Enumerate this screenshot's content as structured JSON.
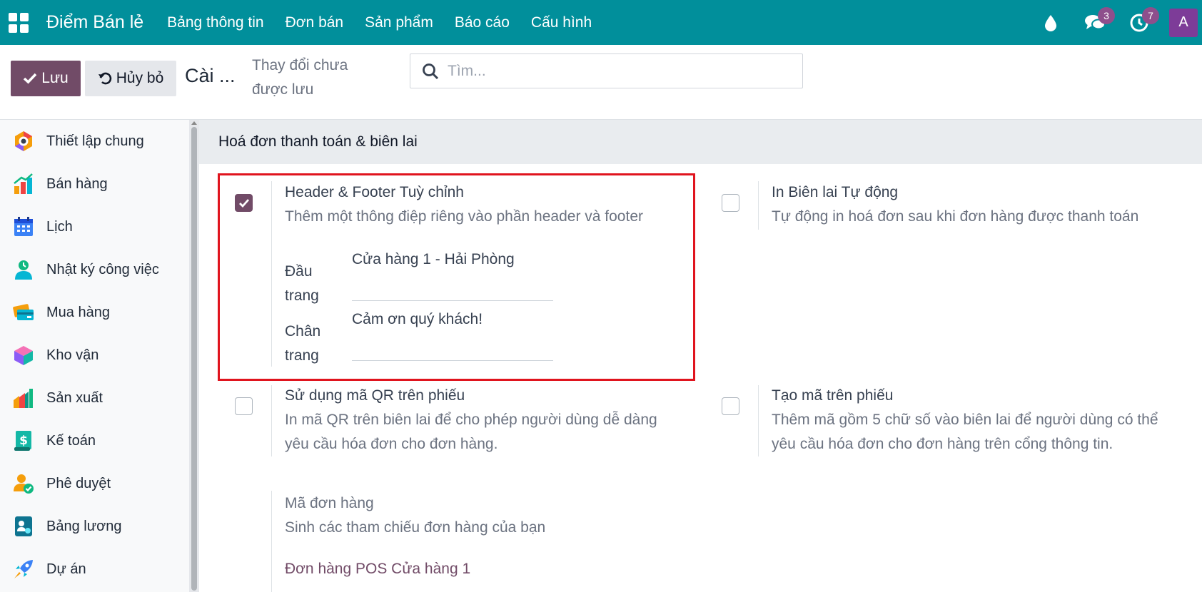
{
  "topbar": {
    "app_name": "Điểm Bán lẻ",
    "nav": [
      "Bảng thông tin",
      "Đơn bán",
      "Sản phẩm",
      "Báo cáo",
      "Cấu hình"
    ],
    "messages_count": "3",
    "activities_count": "7",
    "avatar_letter": "A",
    "color": "#018f9b"
  },
  "control": {
    "save_label": "Lưu",
    "discard_label": "Hủy bỏ",
    "breadcrumb": "Cài ...",
    "unsaved_text": "Thay đổi chưa được lưu",
    "search_placeholder": "Tìm..."
  },
  "sidebar": {
    "items": [
      {
        "label": "Thiết lập chung",
        "icon": "settings-icon"
      },
      {
        "label": "Bán hàng",
        "icon": "sales-chart-icon"
      },
      {
        "label": "Lịch",
        "icon": "calendar-icon"
      },
      {
        "label": "Nhật ký công việc",
        "icon": "timesheet-icon"
      },
      {
        "label": "Mua hàng",
        "icon": "purchase-card-icon"
      },
      {
        "label": "Kho vận",
        "icon": "inventory-box-icon"
      },
      {
        "label": "Sản xuất",
        "icon": "manufacturing-icon"
      },
      {
        "label": "Kế toán",
        "icon": "accounting-icon"
      },
      {
        "label": "Phê duyệt",
        "icon": "approvals-icon"
      },
      {
        "label": "Bảng lương",
        "icon": "payroll-icon"
      },
      {
        "label": "Dự án",
        "icon": "project-rocket-icon"
      }
    ]
  },
  "main": {
    "section_title": "Hoá đơn thanh toán & biên lai",
    "header_footer": {
      "title": "Header & Footer Tuỳ chỉnh",
      "desc": "Thêm một thông điệp riêng vào phần header và footer",
      "checked": true,
      "header_label": "Đầu trang",
      "header_value": "Cửa hàng 1 - Hải Phòng",
      "footer_label": "Chân trang",
      "footer_value": "Cảm ơn quý khách!"
    },
    "auto_print": {
      "title": "In Biên lai Tự động",
      "desc": "Tự động in hoá đơn sau khi đơn hàng được thanh toán",
      "checked": false
    },
    "qr_code": {
      "title": "Sử dụng mã QR trên phiếu",
      "desc": "In mã QR trên biên lai để cho phép người dùng dễ dàng yêu cầu hóa đơn cho đơn hàng.",
      "checked": false
    },
    "ticket_code": {
      "title": "Tạo mã trên phiếu",
      "desc": "Thêm mã gồm 5 chữ số vào biên lai để người dùng có thể yêu cầu hóa đơn cho đơn hàng trên cổng thông tin.",
      "checked": false
    },
    "order_ref": {
      "title": "Mã đơn hàng",
      "desc": "Sinh các tham chiếu đơn hàng của bạn",
      "link": "Đơn hàng POS Cửa hàng 1"
    }
  }
}
